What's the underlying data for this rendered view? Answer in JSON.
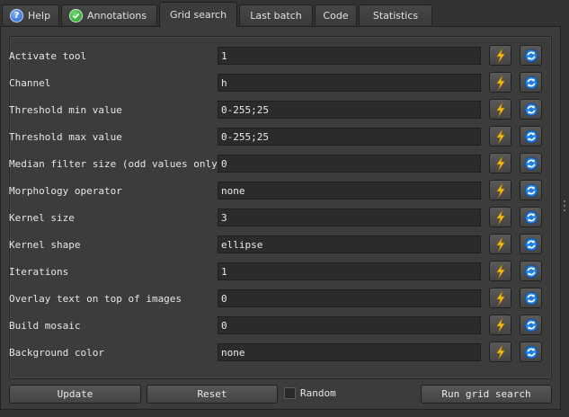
{
  "tabs": [
    {
      "label": "Help",
      "icon": "help-icon"
    },
    {
      "label": "Annotations",
      "icon": "checkmark-icon"
    },
    {
      "label": "Grid search",
      "active": true
    },
    {
      "label": "Last batch"
    },
    {
      "label": "Code"
    },
    {
      "label": "Statistics"
    }
  ],
  "rows": [
    {
      "label": "Activate tool",
      "value": "1"
    },
    {
      "label": "Channel",
      "value": "h"
    },
    {
      "label": "Threshold min value",
      "value": "0-255;25"
    },
    {
      "label": "Threshold max value",
      "value": "0-255;25"
    },
    {
      "label": "Median filter size (odd values only)",
      "value": "0"
    },
    {
      "label": "Morphology operator",
      "value": "none"
    },
    {
      "label": "Kernel size",
      "value": "3"
    },
    {
      "label": "Kernel shape",
      "value": "ellipse"
    },
    {
      "label": "Iterations",
      "value": "1"
    },
    {
      "label": "Overlay text on top of images",
      "value": "0"
    },
    {
      "label": "Build mosaic",
      "value": "0"
    },
    {
      "label": "Background color",
      "value": "none"
    }
  ],
  "row_buttons": {
    "left_icon": "lightning-icon",
    "right_icon": "refresh-icon"
  },
  "bottom": {
    "update_label": "Update",
    "reset_label": "Reset",
    "random_label": "Random",
    "random_checked": false,
    "run_label": "Run grid search"
  },
  "colors": {
    "lightning": "#f3b81a",
    "refresh_blue": "#1e7fe0"
  }
}
